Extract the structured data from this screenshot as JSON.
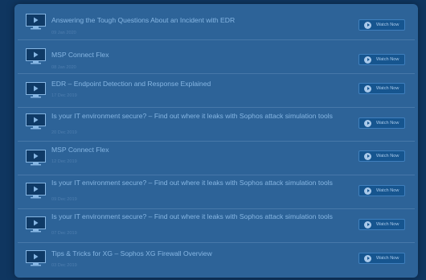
{
  "videos": [
    {
      "title": "Answering the Tough Questions About an Incident with EDR",
      "date": "09 Jan 2020",
      "button": "Watch Now"
    },
    {
      "title": "MSP Connect Flex",
      "date": "08 Jan 2020",
      "button": "Watch Now"
    },
    {
      "title": "EDR – Endpoint Detection and Response Explained",
      "date": "17 Dec 2019",
      "button": "Watch Now"
    },
    {
      "title": "Is your IT environment secure? – Find out where it leaks with Sophos attack simulation tools",
      "date": "20 Dec 2019",
      "button": "Watch Now"
    },
    {
      "title": "MSP Connect Flex",
      "date": "12 Dec 2019",
      "button": "Watch Now"
    },
    {
      "title": "Is your IT environment secure? – Find out where it leaks with Sophos attack simulation tools",
      "date": "09 Dec 2019",
      "button": "Watch Now"
    },
    {
      "title": "Is your IT environment secure? – Find out where it leaks with Sophos attack simulation tools",
      "date": "07 Dec 2019",
      "button": "Watch Now"
    },
    {
      "title": "Tips & Tricks for XG – Sophos XG Firewall Overview",
      "date": "03 Dec 2019",
      "button": "Watch Now"
    }
  ]
}
